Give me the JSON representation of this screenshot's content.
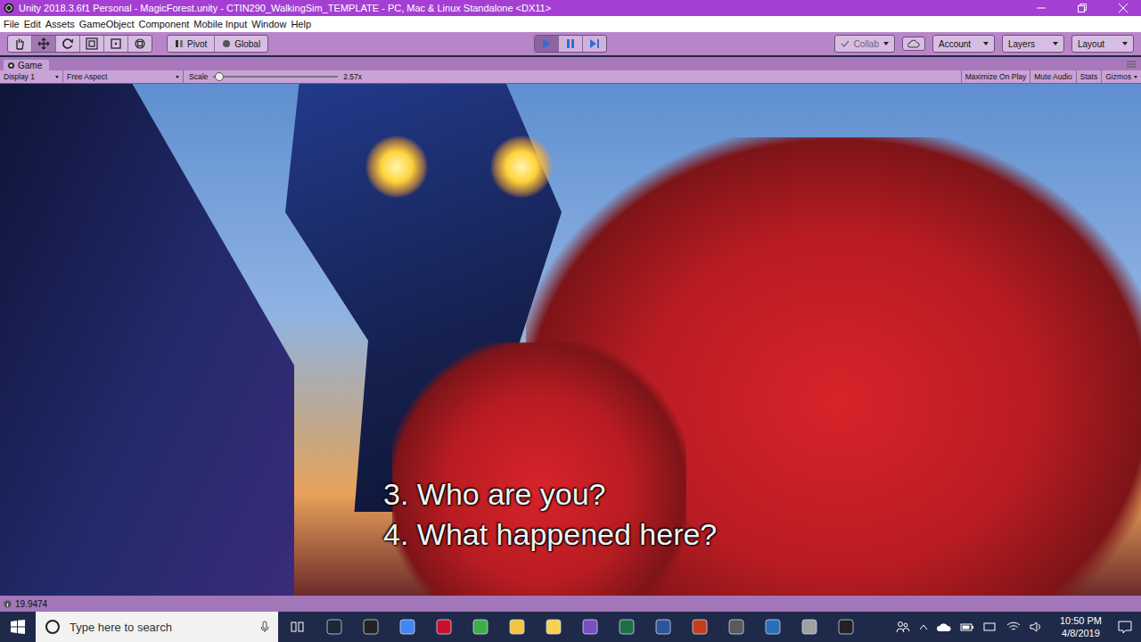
{
  "window": {
    "title": "Unity 2018.3.6f1 Personal - MagicForest.unity - CTIN290_WalkingSim_TEMPLATE - PC, Mac & Linux Standalone <DX11>"
  },
  "menu": [
    "File",
    "Edit",
    "Assets",
    "GameObject",
    "Component",
    "Mobile Input",
    "Window",
    "Help"
  ],
  "toolbar": {
    "tools": [
      {
        "kind": "hand",
        "selected": false
      },
      {
        "kind": "move",
        "selected": true
      },
      {
        "kind": "rotate",
        "selected": false
      },
      {
        "kind": "scale",
        "selected": false
      },
      {
        "kind": "rect",
        "selected": false
      },
      {
        "kind": "transform",
        "selected": false
      }
    ],
    "handles": [
      "Pivot",
      "Global"
    ],
    "playback": {
      "playing": true,
      "paused": false
    },
    "collab": "Collab",
    "account": "Account",
    "layers": "Layers",
    "layout": "Layout"
  },
  "game": {
    "tab": "Game",
    "display": "Display 1",
    "aspect": "Free Aspect",
    "scale": {
      "label": "Scale",
      "value": "2.57x",
      "level": 0.02
    },
    "toggles": [
      {
        "label": "Maximize On Play",
        "on": false
      },
      {
        "label": "Mute Audio",
        "on": false
      },
      {
        "label": "Stats",
        "on": false
      },
      {
        "label": "Gizmos",
        "on": false
      }
    ],
    "dialogue": [
      "3. Who are you?",
      "4. What happened here?"
    ]
  },
  "status_bar": {
    "text": "19.9474"
  },
  "taskbar": {
    "search": {
      "placeholder": "Type here to search"
    },
    "time": "10:50 PM",
    "date": "4/8/2019"
  }
}
